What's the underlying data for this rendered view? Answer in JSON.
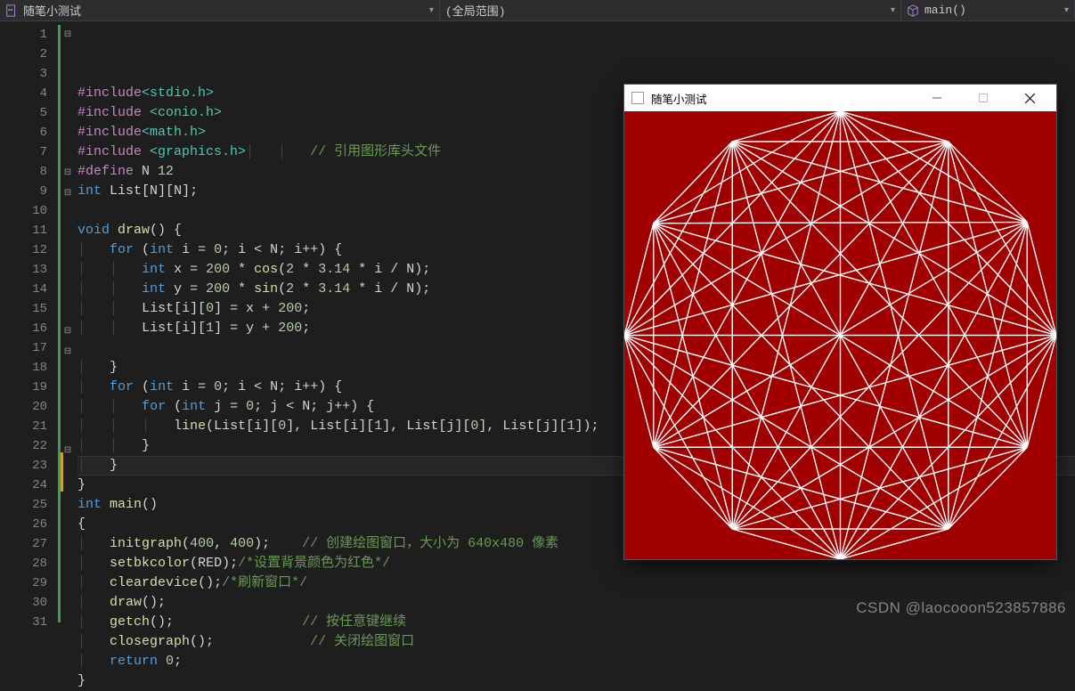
{
  "topbar": {
    "file_label": "随笔小测试",
    "scope_label": "(全局范围)",
    "func_label": "main()"
  },
  "gutter": {
    "lines": 31
  },
  "code": {
    "lines": [
      [
        [
          "pre",
          "#include"
        ],
        [
          "inc",
          "<stdio.h>"
        ]
      ],
      [
        [
          "pre",
          "#include "
        ],
        [
          "inc",
          "<conio.h>"
        ]
      ],
      [
        [
          "pre",
          "#include"
        ],
        [
          "inc",
          "<math.h>"
        ]
      ],
      [
        [
          "pre",
          "#include "
        ],
        [
          "inc",
          "<graphics.h>"
        ],
        [
          "id",
          "\t\t"
        ],
        [
          "cm",
          "// 引用图形库头文件"
        ]
      ],
      [
        [
          "pre",
          "#define "
        ],
        [
          "id",
          "N "
        ],
        [
          "num",
          "12"
        ]
      ],
      [
        [
          "ty",
          "int "
        ],
        [
          "id",
          "List"
        ],
        [
          "op",
          "["
        ],
        [
          "id",
          "N"
        ],
        [
          "op",
          "]["
        ],
        [
          "id",
          "N"
        ],
        [
          "op",
          "];"
        ]
      ],
      [],
      [
        [
          "ty",
          "void "
        ],
        [
          "fn",
          "draw"
        ],
        [
          "op",
          "() {"
        ]
      ],
      [
        [
          "id",
          "    "
        ],
        [
          "kw",
          "for"
        ],
        [
          "op",
          " ("
        ],
        [
          "ty",
          "int "
        ],
        [
          "id",
          "i"
        ],
        [
          "op",
          " = "
        ],
        [
          "num",
          "0"
        ],
        [
          "op",
          "; "
        ],
        [
          "id",
          "i"
        ],
        [
          "op",
          " < "
        ],
        [
          "id",
          "N"
        ],
        [
          "op",
          "; "
        ],
        [
          "id",
          "i"
        ],
        [
          "op",
          "++) {"
        ]
      ],
      [
        [
          "id",
          "        "
        ],
        [
          "ty",
          "int "
        ],
        [
          "id",
          "x"
        ],
        [
          "op",
          " = "
        ],
        [
          "num",
          "200"
        ],
        [
          "op",
          " * "
        ],
        [
          "fn",
          "cos"
        ],
        [
          "op",
          "("
        ],
        [
          "num",
          "2"
        ],
        [
          "op",
          " * "
        ],
        [
          "num",
          "3.14"
        ],
        [
          "op",
          " * "
        ],
        [
          "id",
          "i"
        ],
        [
          "op",
          " / "
        ],
        [
          "id",
          "N"
        ],
        [
          "op",
          ");"
        ]
      ],
      [
        [
          "id",
          "        "
        ],
        [
          "ty",
          "int "
        ],
        [
          "id",
          "y"
        ],
        [
          "op",
          " = "
        ],
        [
          "num",
          "200"
        ],
        [
          "op",
          " * "
        ],
        [
          "fn",
          "sin"
        ],
        [
          "op",
          "("
        ],
        [
          "num",
          "2"
        ],
        [
          "op",
          " * "
        ],
        [
          "num",
          "3.14"
        ],
        [
          "op",
          " * "
        ],
        [
          "id",
          "i"
        ],
        [
          "op",
          " / "
        ],
        [
          "id",
          "N"
        ],
        [
          "op",
          ");"
        ]
      ],
      [
        [
          "id",
          "        "
        ],
        [
          "id",
          "List"
        ],
        [
          "op",
          "["
        ],
        [
          "id",
          "i"
        ],
        [
          "op",
          "]["
        ],
        [
          "num",
          "0"
        ],
        [
          "op",
          "] = "
        ],
        [
          "id",
          "x"
        ],
        [
          "op",
          " + "
        ],
        [
          "num",
          "200"
        ],
        [
          "op",
          ";"
        ]
      ],
      [
        [
          "id",
          "        "
        ],
        [
          "id",
          "List"
        ],
        [
          "op",
          "["
        ],
        [
          "id",
          "i"
        ],
        [
          "op",
          "]["
        ],
        [
          "num",
          "1"
        ],
        [
          "op",
          "] = "
        ],
        [
          "id",
          "y"
        ],
        [
          "op",
          " + "
        ],
        [
          "num",
          "200"
        ],
        [
          "op",
          ";"
        ]
      ],
      [],
      [
        [
          "id",
          "    "
        ],
        [
          "op",
          "}"
        ]
      ],
      [
        [
          "id",
          "    "
        ],
        [
          "kw",
          "for"
        ],
        [
          "op",
          " ("
        ],
        [
          "ty",
          "int "
        ],
        [
          "id",
          "i"
        ],
        [
          "op",
          " = "
        ],
        [
          "num",
          "0"
        ],
        [
          "op",
          "; "
        ],
        [
          "id",
          "i"
        ],
        [
          "op",
          " < "
        ],
        [
          "id",
          "N"
        ],
        [
          "op",
          "; "
        ],
        [
          "id",
          "i"
        ],
        [
          "op",
          "++) {"
        ]
      ],
      [
        [
          "id",
          "        "
        ],
        [
          "kw",
          "for"
        ],
        [
          "op",
          " ("
        ],
        [
          "ty",
          "int "
        ],
        [
          "id",
          "j"
        ],
        [
          "op",
          " = "
        ],
        [
          "num",
          "0"
        ],
        [
          "op",
          "; "
        ],
        [
          "id",
          "j"
        ],
        [
          "op",
          " < "
        ],
        [
          "id",
          "N"
        ],
        [
          "op",
          "; "
        ],
        [
          "id",
          "j"
        ],
        [
          "op",
          "++) {"
        ]
      ],
      [
        [
          "id",
          "            "
        ],
        [
          "fn",
          "line"
        ],
        [
          "op",
          "("
        ],
        [
          "id",
          "List"
        ],
        [
          "op",
          "["
        ],
        [
          "id",
          "i"
        ],
        [
          "op",
          "]["
        ],
        [
          "num",
          "0"
        ],
        [
          "op",
          "], "
        ],
        [
          "id",
          "List"
        ],
        [
          "op",
          "["
        ],
        [
          "id",
          "i"
        ],
        [
          "op",
          "]["
        ],
        [
          "num",
          "1"
        ],
        [
          "op",
          "], "
        ],
        [
          "id",
          "List"
        ],
        [
          "op",
          "["
        ],
        [
          "id",
          "j"
        ],
        [
          "op",
          "]["
        ],
        [
          "num",
          "0"
        ],
        [
          "op",
          "], "
        ],
        [
          "id",
          "List"
        ],
        [
          "op",
          "["
        ],
        [
          "id",
          "j"
        ],
        [
          "op",
          "]["
        ],
        [
          "num",
          "1"
        ],
        [
          "op",
          "]);"
        ]
      ],
      [
        [
          "id",
          "        "
        ],
        [
          "op",
          "}"
        ]
      ],
      [
        [
          "id",
          "    "
        ],
        [
          "op",
          "}"
        ]
      ],
      [
        [
          "op",
          "}"
        ]
      ],
      [
        [
          "ty",
          "int "
        ],
        [
          "fn",
          "main"
        ],
        [
          "op",
          "()"
        ]
      ],
      [
        [
          "op",
          "{"
        ]
      ],
      [
        [
          "id",
          "    "
        ],
        [
          "fn",
          "initgraph"
        ],
        [
          "op",
          "("
        ],
        [
          "num",
          "400"
        ],
        [
          "op",
          ", "
        ],
        [
          "num",
          "400"
        ],
        [
          "op",
          ");\t"
        ],
        [
          "cm",
          "// 创建绘图窗口，大小为 640x480 像素"
        ]
      ],
      [
        [
          "id",
          "    "
        ],
        [
          "fn",
          "setbkcolor"
        ],
        [
          "op",
          "("
        ],
        [
          "id",
          "RED"
        ],
        [
          "op",
          ");"
        ],
        [
          "cm",
          "/*设置背景颜色为红色*/"
        ]
      ],
      [
        [
          "id",
          "    "
        ],
        [
          "fn",
          "cleardevice"
        ],
        [
          "op",
          "();"
        ],
        [
          "cm",
          "/*刷新窗口*/"
        ]
      ],
      [
        [
          "id",
          "    "
        ],
        [
          "fn",
          "draw"
        ],
        [
          "op",
          "();"
        ]
      ],
      [
        [
          "id",
          "    "
        ],
        [
          "fn",
          "getch"
        ],
        [
          "op",
          "();\t\t\t\t"
        ],
        [
          "cm",
          "// 按任意键继续"
        ]
      ],
      [
        [
          "id",
          "    "
        ],
        [
          "fn",
          "closegraph"
        ],
        [
          "op",
          "();\t\t\t"
        ],
        [
          "cm",
          "// 关闭绘图窗口"
        ]
      ],
      [
        [
          "id",
          "    "
        ],
        [
          "kw",
          "return "
        ],
        [
          "num",
          "0"
        ],
        [
          "op",
          ";"
        ]
      ],
      [
        [
          "op",
          "}"
        ]
      ]
    ],
    "folds": {
      "1": "-",
      "8": "-",
      "9": "-",
      "16": "-",
      "17": "-",
      "22": "-"
    }
  },
  "output": {
    "title": "随笔小测试",
    "N": 12,
    "radius": 200,
    "center": 200,
    "bg": "#a00000",
    "line": "#ffffff"
  },
  "watermark": "CSDN @laocooon523857886"
}
